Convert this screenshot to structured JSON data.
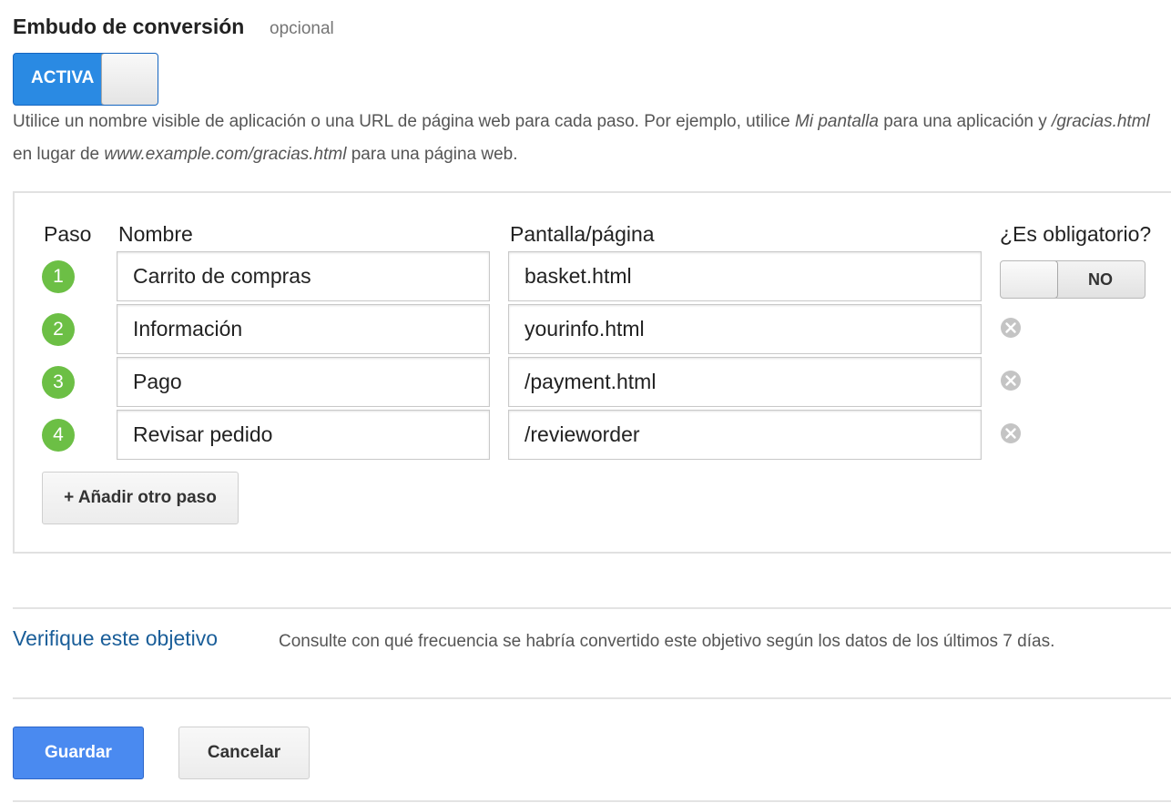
{
  "funnel": {
    "title": "Embudo de conversión",
    "optional_label": "opcional",
    "toggle_label": "ACTIVA",
    "help_text": {
      "part1": "Utilice un nombre visible de aplicación o una URL de página web para cada paso. Por ejemplo, utilice ",
      "example_app": "Mi pantalla",
      "part2": " para una aplicación y ",
      "example_path": "/gracias.html",
      "part3": " en lugar de ",
      "example_url": "www.example.com/gracias.html",
      "part4": " para una página web."
    },
    "columns": {
      "step": "Paso",
      "name": "Nombre",
      "screen_page": "Pantalla/página",
      "required": "¿Es obligatorio?"
    },
    "required_toggle_label": "NO",
    "steps": [
      {
        "number": "1",
        "name": "Carrito de compras",
        "screen": "basket.html"
      },
      {
        "number": "2",
        "name": "Información",
        "screen": "yourinfo.html"
      },
      {
        "number": "3",
        "name": "Pago",
        "screen": "/payment.html"
      },
      {
        "number": "4",
        "name": "Revisar pedido",
        "screen": "/revieworder"
      }
    ],
    "add_step_label": "+ Añadir otro paso"
  },
  "verify": {
    "link_label": "Verifique este objetivo",
    "description": "Consulte con qué frecuencia se habría convertido este objetivo según los datos de los últimos 7 días."
  },
  "actions": {
    "save_label": "Guardar",
    "cancel_label": "Cancelar"
  },
  "colors": {
    "toggle_on": "#2a8ae3",
    "step_badge": "#6cbf45",
    "link": "#1a5e99",
    "primary_button": "#4a8af0"
  },
  "icons": {
    "remove_step": "remove-circle-icon"
  }
}
